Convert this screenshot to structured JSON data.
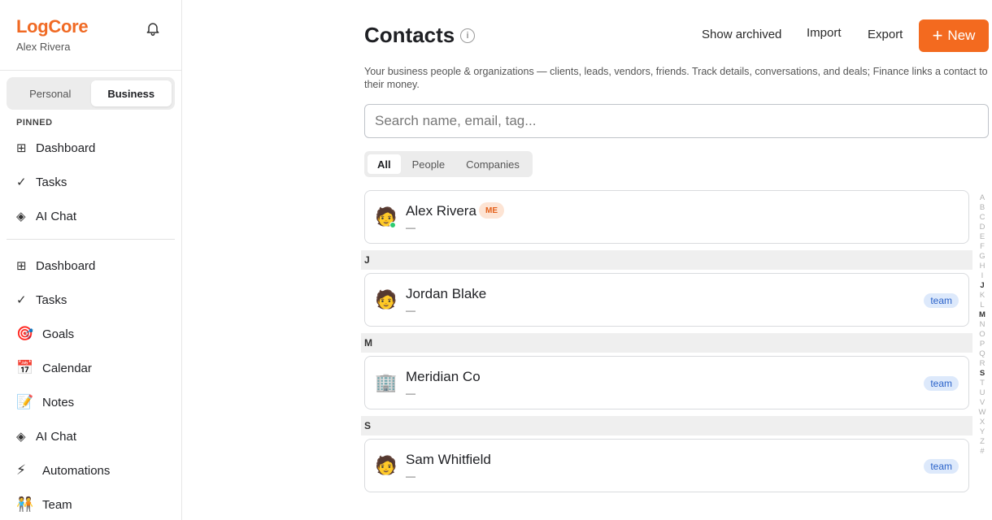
{
  "brand": {
    "name": "LogCore",
    "user": "Alex Rivera"
  },
  "workspace": {
    "options": [
      "Personal",
      "Business"
    ],
    "active": "Business"
  },
  "pinned": {
    "title": "PINNED",
    "items": [
      {
        "label": "Dashboard",
        "icon": "⊞",
        "icon_name": "grid-icon"
      },
      {
        "label": "Tasks",
        "icon": "✓",
        "icon_name": "check-icon"
      },
      {
        "label": "AI Chat",
        "icon": "◈",
        "icon_name": "ai-chat-icon"
      }
    ]
  },
  "nav": {
    "items": [
      {
        "label": "Dashboard",
        "icon": "⊞",
        "icon_name": "grid-icon"
      },
      {
        "label": "Tasks",
        "icon": "✓",
        "icon_name": "check-icon"
      },
      {
        "label": "Goals",
        "icon": "🎯",
        "icon_name": "target-icon"
      },
      {
        "label": "Calendar",
        "icon": "📅",
        "icon_name": "calendar-icon"
      },
      {
        "label": "Notes",
        "icon": "📝",
        "icon_name": "memo-icon"
      },
      {
        "label": "AI Chat",
        "icon": "◈",
        "icon_name": "ai-chat-icon"
      },
      {
        "label": "Automations",
        "icon": "⚡",
        "icon_name": "lightning-icon"
      },
      {
        "label": "Team",
        "icon": "🧑‍🤝‍🧑",
        "icon_name": "team-icon"
      }
    ]
  },
  "header": {
    "title": "Contacts",
    "info_icon": "i",
    "show_archived": "Show archived",
    "import": "Import",
    "export": "Export",
    "new": "New",
    "new_icon": "+"
  },
  "subtitle": "Your business people & organizations — clients, leads, vendors, friends. Track details, conversations, and deals; Finance links a contact to their money.",
  "search": {
    "placeholder": "Search name, email, tag...",
    "value": ""
  },
  "filters": {
    "options": [
      "All",
      "People",
      "Companies"
    ],
    "active": "All"
  },
  "me_contact": {
    "name": "Alex Rivera",
    "sub": "—",
    "badge": "ME",
    "avatar": "🧑",
    "online": true
  },
  "groups": [
    {
      "letter": "J",
      "contacts": [
        {
          "name": "Jordan Blake",
          "sub": "—",
          "tag": "team",
          "avatar": "🧑",
          "avatar_name": "person-icon"
        }
      ]
    },
    {
      "letter": "M",
      "contacts": [
        {
          "name": "Meridian Co",
          "sub": "—",
          "tag": "team",
          "avatar": "🏢",
          "avatar_name": "office-building-icon"
        }
      ]
    },
    {
      "letter": "S",
      "contacts": [
        {
          "name": "Sam Whitfield",
          "sub": "—",
          "tag": "team",
          "avatar": "🧑",
          "avatar_name": "person-icon"
        }
      ]
    }
  ],
  "alphabet": [
    "A",
    "B",
    "C",
    "D",
    "E",
    "F",
    "G",
    "H",
    "I",
    "J",
    "K",
    "L",
    "M",
    "N",
    "O",
    "P",
    "Q",
    "R",
    "S",
    "T",
    "U",
    "V",
    "W",
    "X",
    "Y",
    "Z",
    "#"
  ],
  "alphabet_active": [
    "J",
    "M",
    "S"
  ],
  "colors": {
    "accent": "#f36a1f",
    "brand": "#f06a24",
    "online": "#2ecc71",
    "team_badge": "#2a62c9"
  }
}
